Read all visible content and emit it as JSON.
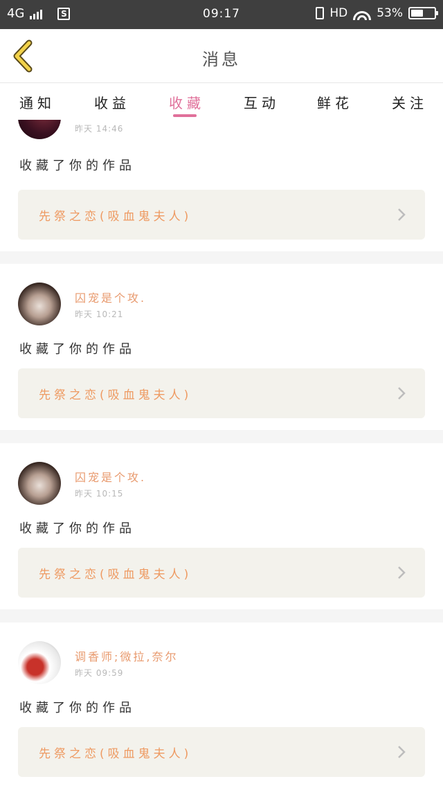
{
  "status_bar": {
    "network": "4G",
    "sim_icon": "S",
    "time": "09:17",
    "hd": "HD",
    "battery_text": "53%",
    "battery_level": 0.53
  },
  "header": {
    "title": "消息"
  },
  "tabs": [
    {
      "label": "通知",
      "active": false
    },
    {
      "label": "收益",
      "active": false
    },
    {
      "label": "收藏",
      "active": true
    },
    {
      "label": "互动",
      "active": false
    },
    {
      "label": "鲜花",
      "active": false
    },
    {
      "label": "关注",
      "active": false
    }
  ],
  "colors": {
    "accent": "#e0709a",
    "username": "#e89a6e",
    "work_title": "#ee9a62",
    "card_bg": "#f3f2ec"
  },
  "items": [
    {
      "user": "",
      "time": "昨天 14:46",
      "action": "收藏了你的作品",
      "work": "先祭之恋(吸血鬼夫人)"
    },
    {
      "user": "囚宠是个攻.",
      "time": "昨天 10:21",
      "action": "收藏了你的作品",
      "work": "先祭之恋(吸血鬼夫人)"
    },
    {
      "user": "囚宠是个攻.",
      "time": "昨天 10:15",
      "action": "收藏了你的作品",
      "work": "先祭之恋(吸血鬼夫人)"
    },
    {
      "user": "调香师;微拉,奈尔",
      "time": "昨天 09:59",
      "action": "收藏了你的作品",
      "work": "先祭之恋(吸血鬼夫人)"
    }
  ]
}
